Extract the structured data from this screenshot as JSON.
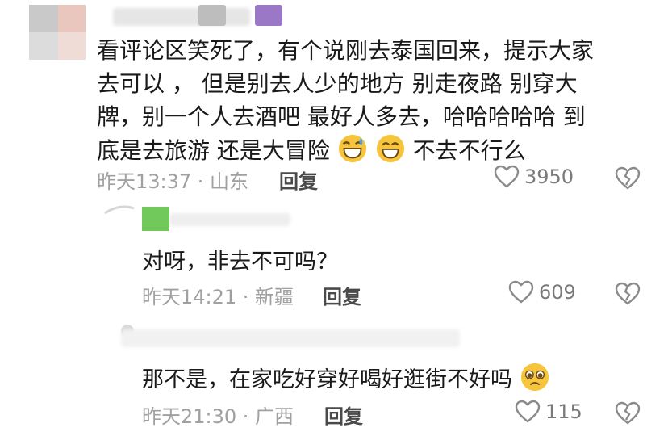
{
  "comments": [
    {
      "text_line1": "看评论区笑死了，有个说刚去泰国回来，提示大家",
      "text_line2": "去可以 ， 但是别去人少的地方 别走夜路 别穿大",
      "text_line3": "牌，别一个人去酒吧 最好人多去，哈哈哈哈哈 到",
      "text_line4_a": "底是去旅游 还是大冒险",
      "text_line4_b": "不去不行么",
      "meta": "昨天13:37 · 山东",
      "reply_label": "回复",
      "likes": "3950"
    },
    {
      "text": "对呀，非去不可吗？",
      "meta": "昨天14:21 · 新疆",
      "reply_label": "回复",
      "likes": "609"
    },
    {
      "text": "那不是，在家吃好穿好喝好逛街不好吗",
      "meta": "昨天21:30 · 广西",
      "reply_label": "回复",
      "likes": "115"
    }
  ],
  "icons": {
    "like": "heart-outline-icon",
    "dislike": "broken-heart-icon",
    "emoji_sweat": "grinning-sweat-emoji",
    "emoji_grin": "grinning-emoji",
    "emoji_pleading": "pleading-face-emoji"
  },
  "colors": {
    "meta_text": "#a0a0a0",
    "icon_stroke": "#8a8a8a",
    "green_badge": "#71c95b",
    "purple_badge": "#9a78c6"
  }
}
